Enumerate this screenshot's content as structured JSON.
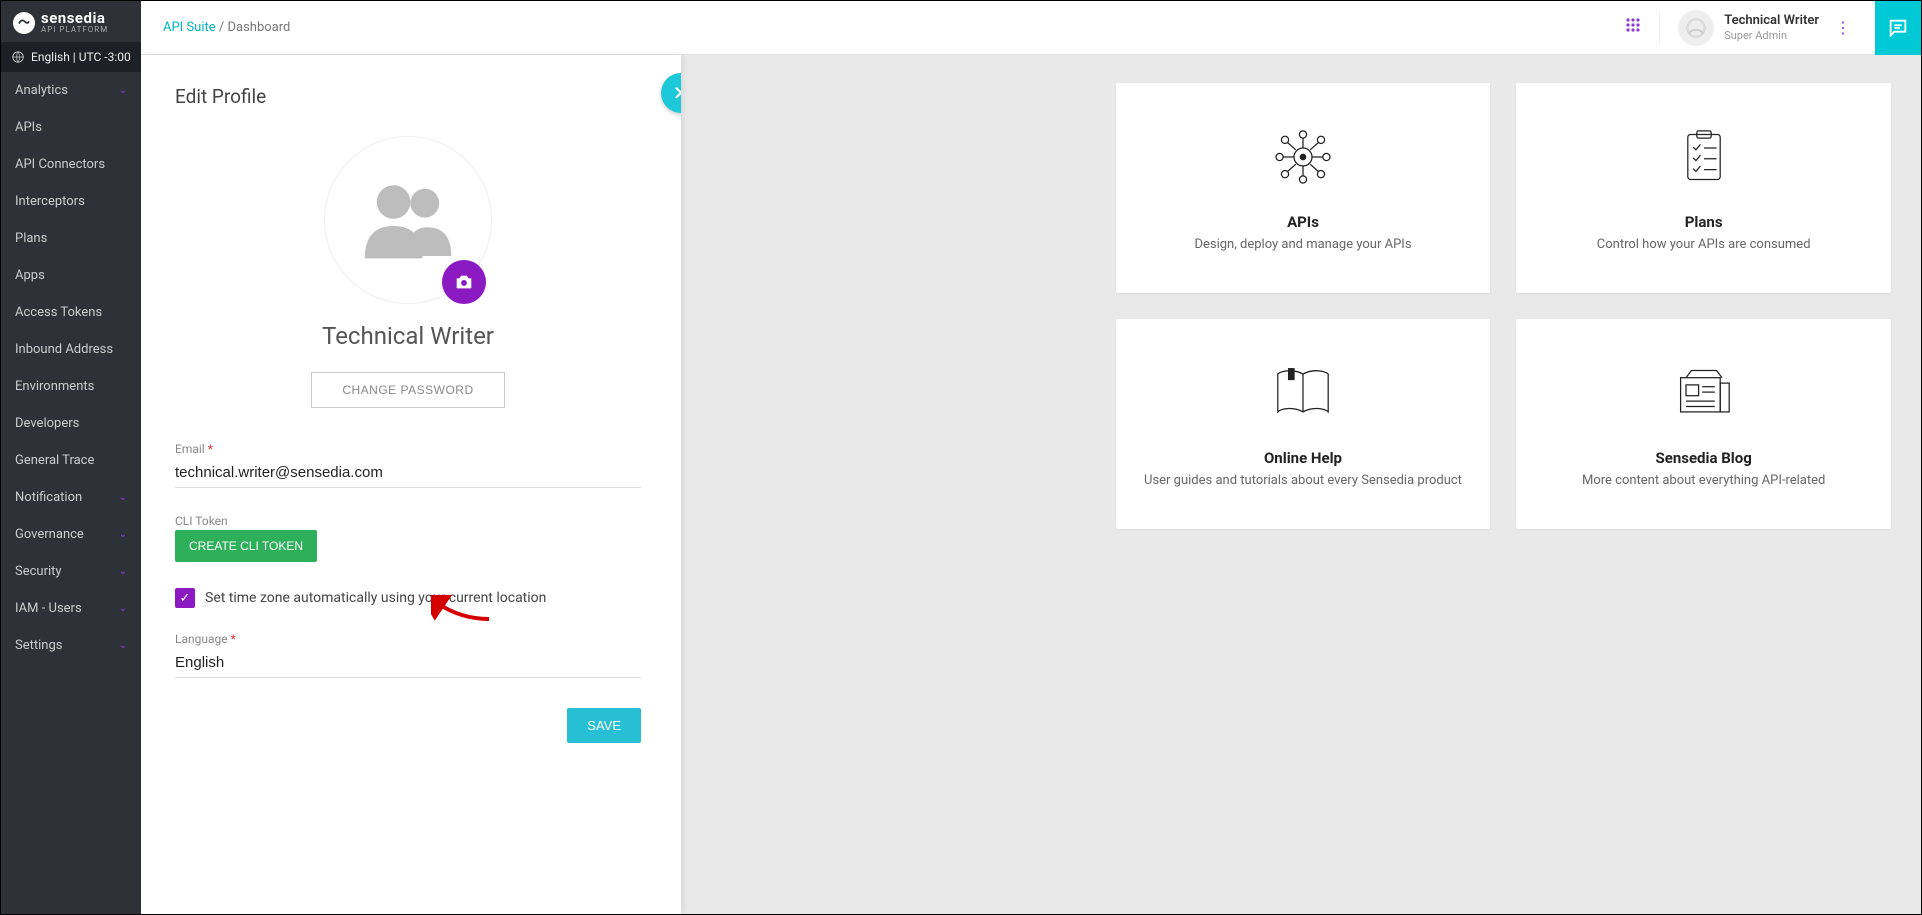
{
  "brand": {
    "name": "sensedia",
    "subtitle": "API PLATFORM"
  },
  "locale": "English | UTC -3:00",
  "breadcrumb": {
    "first": "API Suite",
    "second": "Dashboard"
  },
  "user": {
    "name": "Technical Writer",
    "role": "Super Admin"
  },
  "sidebar": {
    "items": [
      {
        "label": "Analytics",
        "expandable": true
      },
      {
        "label": "APIs",
        "expandable": false
      },
      {
        "label": "API Connectors",
        "expandable": false
      },
      {
        "label": "Interceptors",
        "expandable": false
      },
      {
        "label": "Plans",
        "expandable": false
      },
      {
        "label": "Apps",
        "expandable": false
      },
      {
        "label": "Access Tokens",
        "expandable": false
      },
      {
        "label": "Inbound Address",
        "expandable": false
      },
      {
        "label": "Environments",
        "expandable": false
      },
      {
        "label": "Developers",
        "expandable": false
      },
      {
        "label": "General Trace",
        "expandable": false
      },
      {
        "label": "Notification",
        "expandable": true
      },
      {
        "label": "Governance",
        "expandable": true
      },
      {
        "label": "Security",
        "expandable": true
      },
      {
        "label": "IAM - Users",
        "expandable": true
      },
      {
        "label": "Settings",
        "expandable": true
      }
    ]
  },
  "panel": {
    "title": "Edit Profile",
    "display_name": "Technical Writer",
    "change_password": "CHANGE PASSWORD",
    "email_label": "Email",
    "email_value": "technical.writer@sensedia.com",
    "cli_label": "CLI Token",
    "cli_button": "CREATE CLI TOKEN",
    "tz_label": "Set time zone automatically using your current location",
    "tz_checked": true,
    "lang_label": "Language",
    "lang_value": "English",
    "save": "SAVE"
  },
  "cards": [
    {
      "title": "APIs",
      "desc": "Design, deploy and manage your APIs",
      "icon": "network"
    },
    {
      "title": "Plans",
      "desc": "Control how your APIs are consumed",
      "icon": "checklist"
    },
    {
      "title": "Online Help",
      "desc": "User guides and tutorials about every Sensedia product",
      "icon": "book"
    },
    {
      "title": "Sensedia Blog",
      "desc": "More content about everything API-related",
      "icon": "news"
    }
  ]
}
